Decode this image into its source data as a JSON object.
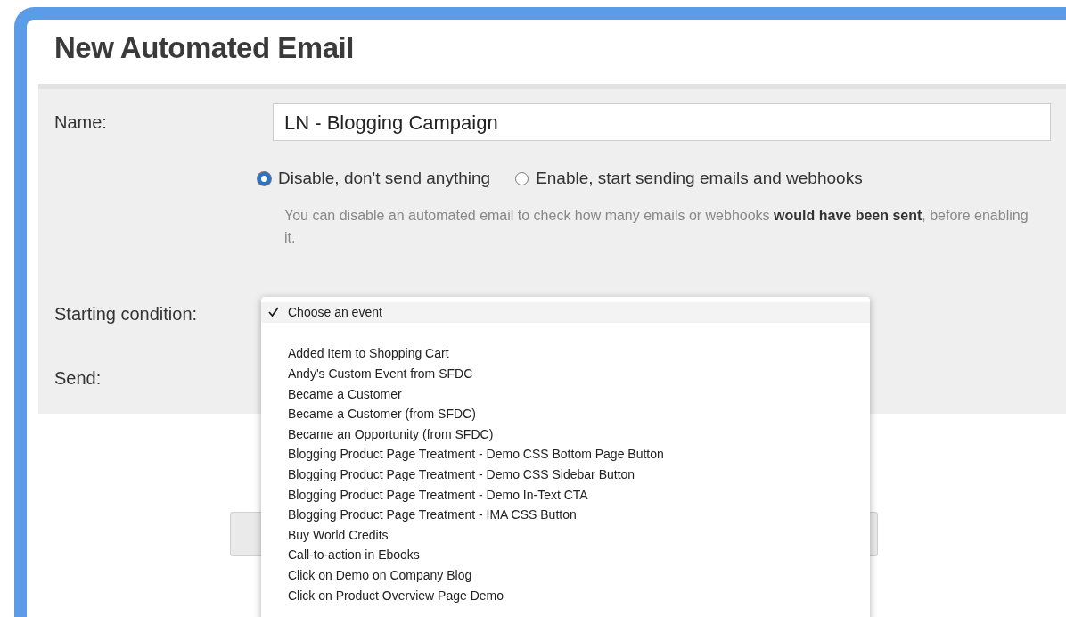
{
  "window": {
    "title": "New Automated Email"
  },
  "form": {
    "name_label": "Name:",
    "name_value": "LN - Blogging Campaign",
    "status_options": [
      {
        "label": "Disable, don't send anything",
        "selected": true
      },
      {
        "label": "Enable, start sending emails and webhooks",
        "selected": false
      }
    ],
    "status_help": "You can disable an automated email to check how many emails or webhooks **would have been sent**, before enabling it.",
    "starting_condition_label": "Starting condition:",
    "send_label": "Send:"
  },
  "event_menu": {
    "items": [
      {
        "label": "Choose an event",
        "selected": true
      },
      {
        "label": "Added Item to Shopping Cart",
        "selected": false
      },
      {
        "label": "Andy's Custom Event from SFDC",
        "selected": false
      },
      {
        "label": "Became a Customer",
        "selected": false
      },
      {
        "label": "Became a Customer (from SFDC)",
        "selected": false
      },
      {
        "label": "Became an Opportunity (from SFDC)",
        "selected": false
      },
      {
        "label": "Blogging Product Page Treatment - Demo CSS Bottom Page Button",
        "selected": false
      },
      {
        "label": "Blogging Product Page Treatment - Demo CSS Sidebar Button",
        "selected": false
      },
      {
        "label": "Blogging Product Page Treatment - Demo In-Text CTA",
        "selected": false
      },
      {
        "label": "Blogging Product Page Treatment - IMA CSS Button",
        "selected": false
      },
      {
        "label": "Buy World Credits",
        "selected": false
      },
      {
        "label": "Call-to-action in Ebooks",
        "selected": false
      },
      {
        "label": "Click on Demo on Company Blog",
        "selected": false
      },
      {
        "label": "Click on Product Overview Page Demo",
        "selected": false
      }
    ]
  }
}
